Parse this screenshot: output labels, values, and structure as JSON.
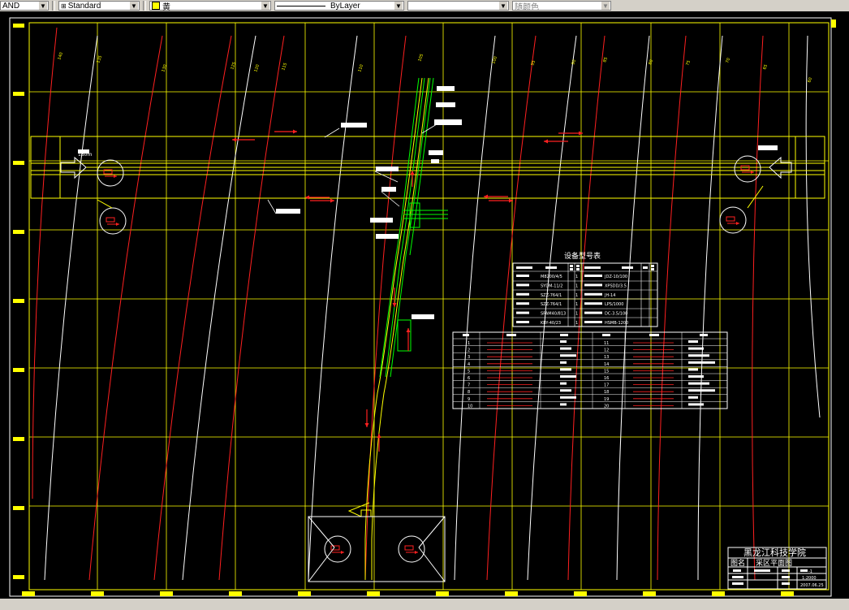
{
  "toolbar": {
    "text_style_cut": "AND",
    "dim_style": "Standard",
    "layer": "黄",
    "linetype": "ByLayer",
    "lineweight": "",
    "plot_color": "随颜色"
  },
  "contours": {
    "labels": [
      "140",
      "135",
      "130",
      "125",
      "120",
      "115",
      "110",
      "105",
      "100",
      "95",
      "90",
      "85",
      "80",
      "75",
      "70",
      "65",
      "60"
    ]
  },
  "drawing": {
    "equipment_table_title": "设备型号表",
    "equipment_rows": [
      [
        "M8200/4/5",
        "1",
        "JDZ-10/100"
      ],
      [
        "SYDM-11/2",
        "1",
        "XPSDD/3.5"
      ],
      [
        "SZZ-764/1",
        "1",
        "JH-14"
      ],
      [
        "SZZ-764/1",
        "1",
        "LPS/1000"
      ],
      [
        "SPAM40/813",
        "1",
        "DC-3.5/100"
      ],
      [
        "KBY-40/23",
        "1",
        "HSMB-1200"
      ]
    ],
    "legend_left_numbers": [
      "1",
      "2",
      "3",
      "4",
      "5",
      "6",
      "7",
      "8",
      "9",
      "10"
    ],
    "legend_right_numbers": [
      "11",
      "12",
      "13",
      "14",
      "15",
      "16",
      "17",
      "18",
      "19",
      "20"
    ],
    "title_block": {
      "school": "黑龙江科技学院",
      "drawing_label": "图名",
      "drawing_name": "采区平面图",
      "drawing_no": "-1",
      "scale": "1:2000",
      "date": "2007.06.25"
    },
    "left_label": "180m"
  }
}
